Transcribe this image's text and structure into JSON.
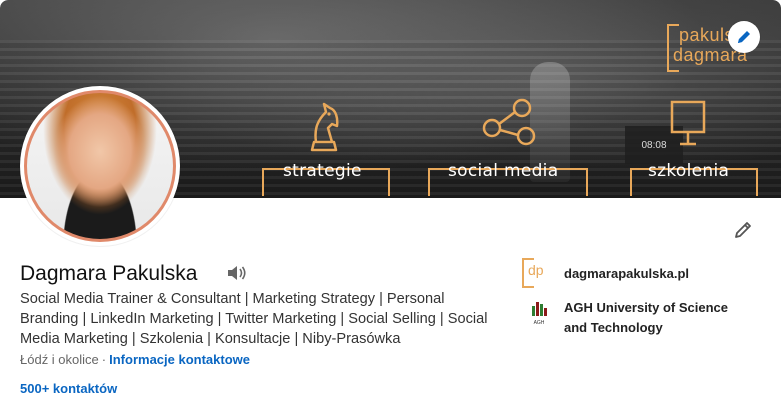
{
  "banner": {
    "brand_line1": "pakulska",
    "brand_line2": "dagmara",
    "labels": [
      "strategie",
      "social media",
      "szkolenia"
    ],
    "screen_text": "08:08",
    "accent_color": "#e8a85a"
  },
  "profile": {
    "name": "Dagmara Pakulska",
    "headline": "Social Media Trainer & Consultant | Marketing Strategy | Personal Branding | LinkedIn Marketing | Twitter Marketing | Social Selling | Social Media Marketing | Szkolenia | Konsultacje | Niby-Prasówka",
    "location": "Łódź i okolice",
    "separator": "·",
    "contact_info": "Informacje kontaktowe",
    "connections": "500+ kontaktów"
  },
  "right_panel": {
    "website": "dagmarapakulska.pl",
    "website_logo_text": "dp",
    "school": "AGH University of Science and Technology",
    "school_logo_text": "AGH"
  },
  "icons": {
    "edit_cover": "pencil-icon",
    "edit_profile": "pencil-icon",
    "pronunciation": "speaker-icon"
  },
  "colors": {
    "link": "#0a66c2",
    "avatar_ring": "#e0896a"
  }
}
